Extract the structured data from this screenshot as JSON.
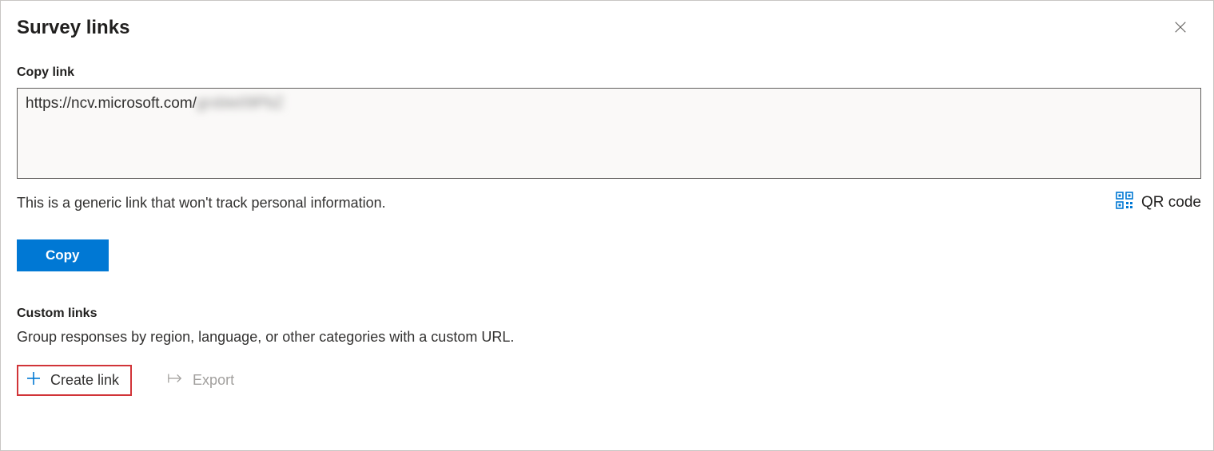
{
  "panel_title": "Survey links",
  "copy_link": {
    "label": "Copy link",
    "url_visible": "https://ncv.microsoft.com/",
    "url_redacted": "grxbte09PbZ",
    "helper": "This is a generic link that won't track personal information.",
    "qr_label": "QR code",
    "copy_button": "Copy"
  },
  "custom_links": {
    "label": "Custom links",
    "description": "Group responses by region, language, or other categories with a custom URL.",
    "create_label": "Create link",
    "export_label": "Export"
  }
}
